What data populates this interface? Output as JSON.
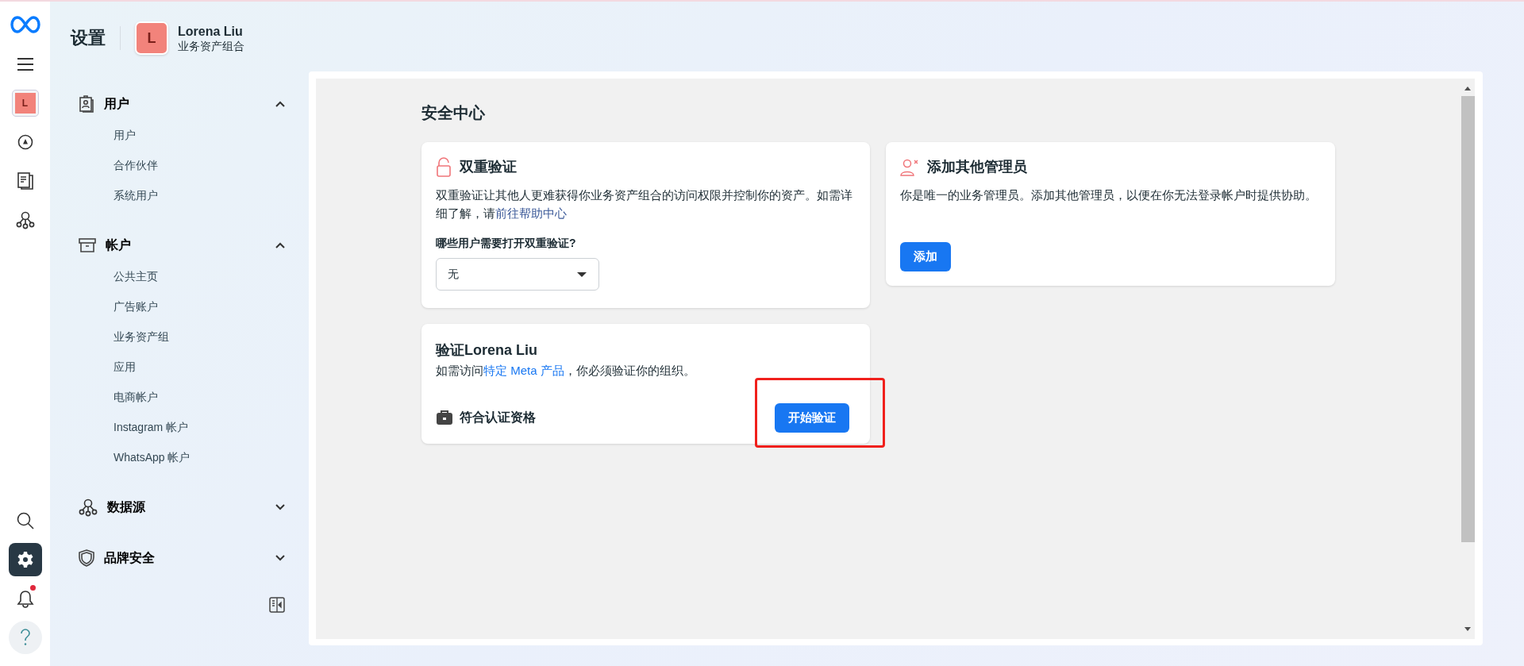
{
  "rail": {
    "top": [
      {
        "kind": "menu",
        "selected": false
      },
      {
        "kind": "avatar",
        "label": "L",
        "selected": false
      },
      {
        "kind": "compass",
        "selected": false
      },
      {
        "kind": "pages",
        "selected": false
      },
      {
        "kind": "network",
        "selected": false
      }
    ],
    "bottom": [
      {
        "kind": "search",
        "selected": false
      },
      {
        "kind": "settings",
        "selected": true
      },
      {
        "kind": "bell",
        "badge": true,
        "selected": false
      },
      {
        "kind": "help",
        "selected": false
      }
    ]
  },
  "header": {
    "title": "设置",
    "account": {
      "avatar": "L",
      "name": "Lorena Liu",
      "subtitle": "业务资产组合"
    }
  },
  "sidebar": {
    "sections": [
      {
        "kind": "badge",
        "label": "用户",
        "expanded": true,
        "items": [
          {
            "label": "用户"
          },
          {
            "label": "合作伙伴"
          },
          {
            "label": "系统用户"
          }
        ]
      },
      {
        "kind": "archive",
        "label": "帐户",
        "expanded": true,
        "items": [
          {
            "label": "公共主页"
          },
          {
            "label": "广告账户"
          },
          {
            "label": "业务资产组"
          },
          {
            "label": "应用"
          },
          {
            "label": "电商帐户"
          },
          {
            "label": "Instagram 帐户"
          },
          {
            "label": "WhatsApp 帐户"
          }
        ]
      },
      {
        "kind": "network",
        "label": "数据源",
        "expanded": false
      },
      {
        "kind": "shield",
        "label": "品牌安全",
        "expanded": false
      }
    ]
  },
  "main": {
    "title": "安全中心",
    "cards": [
      {
        "kind": "two_factor",
        "title": "双重验证",
        "description": "双重验证让其他人更难获得你业务资产组合的访问权限并控制你的资产。如需详细了解，请",
        "link": "前往帮助中心",
        "question": "哪些用户需要打开双重验证?",
        "select_value": "无"
      },
      {
        "kind": "admins",
        "title": "添加其他管理员",
        "description": "你是唯一的业务管理员。添加其他管理员，以便在你无法登录帐户时提供协助。",
        "button": "添加"
      },
      {
        "kind": "verify",
        "title": "验证Lorena Liu",
        "description_before": "如需访问",
        "link": "特定 Meta 产品",
        "description_after": "，你必须验证你的组织。",
        "status": "符合认证资格",
        "button": "开始验证",
        "highlighted": true
      }
    ]
  }
}
